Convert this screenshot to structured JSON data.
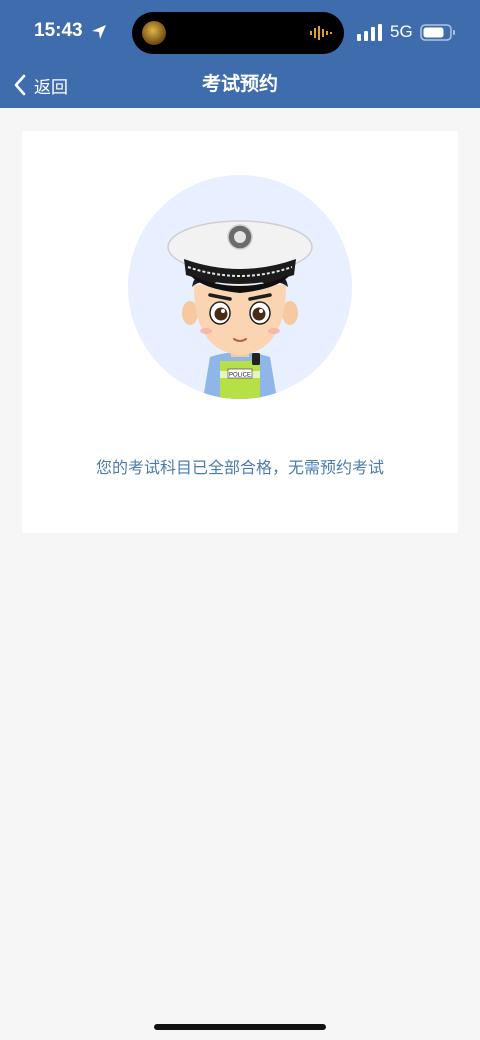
{
  "status_bar": {
    "time": "15:43",
    "network": "5G",
    "icons": [
      "location-arrow-icon",
      "signal-icon",
      "battery-icon"
    ]
  },
  "nav": {
    "back_label": "返回",
    "title": "考试预约"
  },
  "content": {
    "avatar": "police-officer-avatar",
    "badge_text": "POLICE",
    "message": "您的考试科目已全部合格，无需预约考试"
  },
  "colors": {
    "header": "#3f6cad",
    "message": "#4a7cb0",
    "avatar_bg": "#e8efff",
    "page_bg": "#f6f6f6"
  }
}
